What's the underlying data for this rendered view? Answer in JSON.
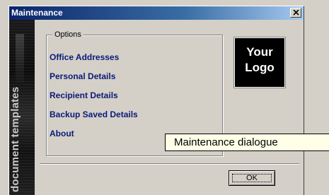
{
  "window": {
    "title": "Maintenance",
    "close_icon": "close-icon"
  },
  "sidebar": {
    "text": "document templates"
  },
  "options": {
    "legend": "Options",
    "items": [
      {
        "label": "Office Addresses"
      },
      {
        "label": "Personal Details"
      },
      {
        "label": "Recipient Details"
      },
      {
        "label": "Backup Saved Details"
      },
      {
        "label": "About"
      }
    ]
  },
  "logo": {
    "text": "Your\nLogo"
  },
  "buttons": {
    "ok_label": "OK"
  },
  "caption": {
    "text": "Maintenance dialogue"
  },
  "colors": {
    "title_bar": "#0a246a",
    "link": "#0a1a78",
    "dialog_bg": "#d4d0c8",
    "logo_bg": "#000000",
    "caption_bg": "#ffffe8"
  }
}
